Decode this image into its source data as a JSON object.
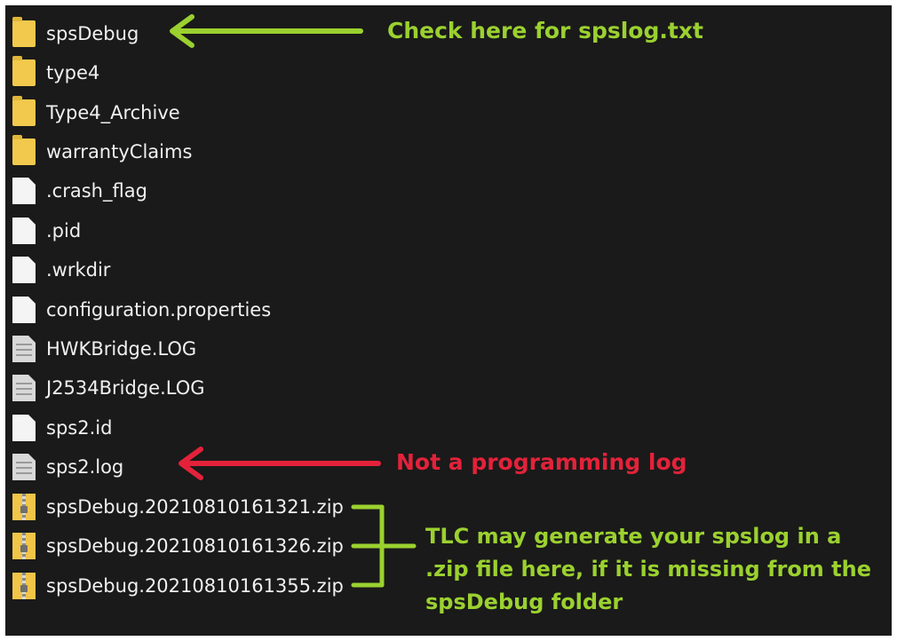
{
  "files": [
    {
      "name": "spsDebug",
      "icon": "folder-icon"
    },
    {
      "name": "type4",
      "icon": "folder-icon"
    },
    {
      "name": "Type4_Archive",
      "icon": "folder-icon"
    },
    {
      "name": "warrantyClaims",
      "icon": "folder-icon"
    },
    {
      "name": ".crash_flag",
      "icon": "file-icon"
    },
    {
      "name": ".pid",
      "icon": "file-icon"
    },
    {
      "name": ".wrkdir",
      "icon": "file-icon"
    },
    {
      "name": "configuration.properties",
      "icon": "file-icon"
    },
    {
      "name": "HWKBridge.LOG",
      "icon": "log-file-icon"
    },
    {
      "name": "J2534Bridge.LOG",
      "icon": "log-file-icon"
    },
    {
      "name": "sps2.id",
      "icon": "file-icon"
    },
    {
      "name": "sps2.log",
      "icon": "log-file-icon"
    },
    {
      "name": "spsDebug.20210810161321.zip",
      "icon": "zip-icon"
    },
    {
      "name": "spsDebug.20210810161326.zip",
      "icon": "zip-icon"
    },
    {
      "name": "spsDebug.20210810161355.zip",
      "icon": "zip-icon"
    }
  ],
  "annotations": {
    "check": "Check here for spslog.txt",
    "not_log": "Not a programming log",
    "tlc_line1": "TLC may generate your spslog in a",
    "tlc_line2": ".zip file here, if it is missing from the",
    "tlc_line3": "spsDebug folder"
  },
  "colors": {
    "background": "#1a1a1a",
    "green_annotation": "#9bd12f",
    "red_annotation": "#e3223a"
  }
}
